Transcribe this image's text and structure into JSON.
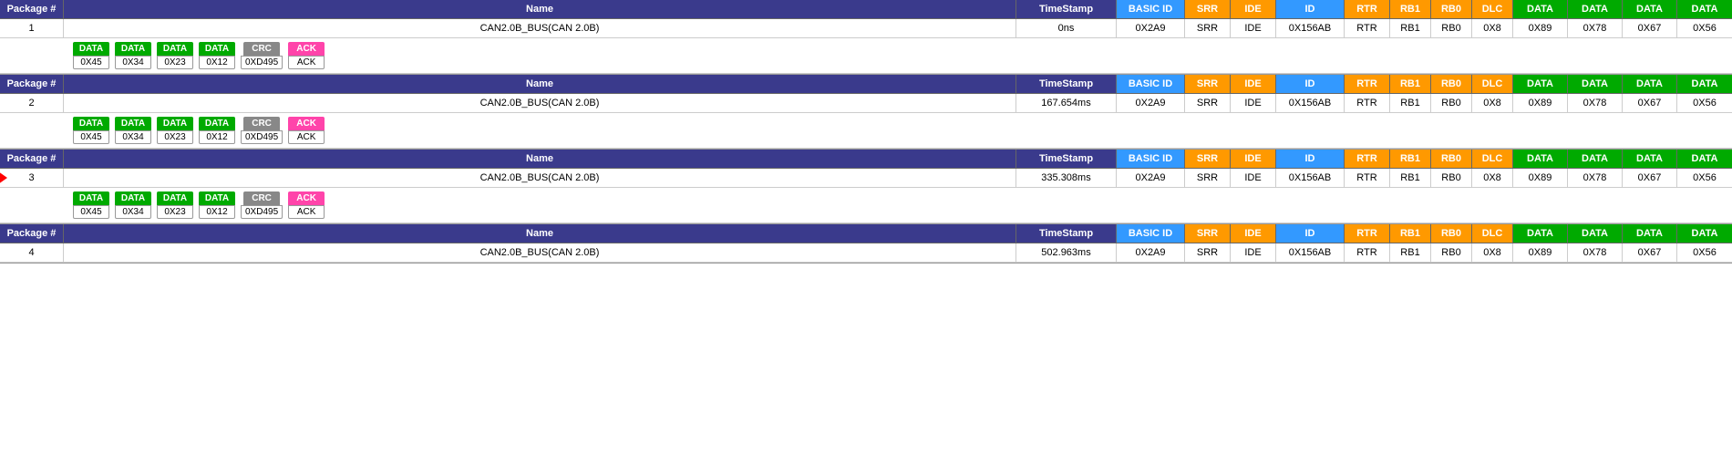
{
  "table": {
    "headers": {
      "pkg": "Package #",
      "name": "Name",
      "timestamp": "TimeStamp",
      "basic_id": "BASIC ID",
      "srr": "SRR",
      "ide": "IDE",
      "id": "ID",
      "rtr": "RTR",
      "rb1": "RB1",
      "rb0": "RB0",
      "dlc": "DLC",
      "data1": "DATA",
      "data2": "DATA",
      "data3": "DATA",
      "data4": "DATA"
    },
    "packets": [
      {
        "pkg": "1",
        "name": "CAN2.0B_BUS(CAN 2.0B)",
        "timestamp": "0ns",
        "basic_id": "0X2A9",
        "srr": "SRR",
        "ide": "IDE",
        "id": "0X156AB",
        "rtr": "RTR",
        "rb1": "RB1",
        "rb0": "RB0",
        "dlc": "0X8",
        "data1": "0X89",
        "data2": "0X78",
        "data3": "0X67",
        "data4": "0X56",
        "detail": [
          {
            "label": "DATA",
            "value": "0X45",
            "color": "green"
          },
          {
            "label": "DATA",
            "value": "0X34",
            "color": "green"
          },
          {
            "label": "DATA",
            "value": "0X23",
            "color": "green"
          },
          {
            "label": "DATA",
            "value": "0X12",
            "color": "green"
          },
          {
            "label": "CRC",
            "value": "0XD495",
            "color": "gray"
          },
          {
            "label": "ACK",
            "value": "ACK",
            "color": "pink"
          }
        ],
        "highlighted": false
      },
      {
        "pkg": "2",
        "name": "CAN2.0B_BUS(CAN 2.0B)",
        "timestamp": "167.654ms",
        "basic_id": "0X2A9",
        "srr": "SRR",
        "ide": "IDE",
        "id": "0X156AB",
        "rtr": "RTR",
        "rb1": "RB1",
        "rb0": "RB0",
        "dlc": "0X8",
        "data1": "0X89",
        "data2": "0X78",
        "data3": "0X67",
        "data4": "0X56",
        "detail": [
          {
            "label": "DATA",
            "value": "0X45",
            "color": "green"
          },
          {
            "label": "DATA",
            "value": "0X34",
            "color": "green"
          },
          {
            "label": "DATA",
            "value": "0X23",
            "color": "green"
          },
          {
            "label": "DATA",
            "value": "0X12",
            "color": "green"
          },
          {
            "label": "CRC",
            "value": "0XD495",
            "color": "gray"
          },
          {
            "label": "ACK",
            "value": "ACK",
            "color": "pink"
          }
        ],
        "highlighted": false
      },
      {
        "pkg": "3",
        "name": "CAN2.0B_BUS(CAN 2.0B)",
        "timestamp": "335.308ms",
        "basic_id": "0X2A9",
        "srr": "SRR",
        "ide": "IDE",
        "id": "0X156AB",
        "rtr": "RTR",
        "rb1": "RB1",
        "rb0": "RB0",
        "dlc": "0X8",
        "data1": "0X89",
        "data2": "0X78",
        "data3": "0X67",
        "data4": "0X56",
        "detail": [
          {
            "label": "DATA",
            "value": "0X45",
            "color": "green"
          },
          {
            "label": "DATA",
            "value": "0X34",
            "color": "green"
          },
          {
            "label": "DATA",
            "value": "0X23",
            "color": "green"
          },
          {
            "label": "DATA",
            "value": "0X12",
            "color": "green"
          },
          {
            "label": "CRC",
            "value": "0XD495",
            "color": "gray"
          },
          {
            "label": "ACK",
            "value": "ACK",
            "color": "pink"
          }
        ],
        "highlighted": true
      },
      {
        "pkg": "4",
        "name": "CAN2.0B_BUS(CAN 2.0B)",
        "timestamp": "502.963ms",
        "basic_id": "0X2A9",
        "srr": "SRR",
        "ide": "IDE",
        "id": "0X156AB",
        "rtr": "RTR",
        "rb1": "RB1",
        "rb0": "RB0",
        "dlc": "0X8",
        "data1": "0X89",
        "data2": "0X78",
        "data3": "0X67",
        "data4": "0X56",
        "detail": [],
        "highlighted": false
      }
    ]
  }
}
